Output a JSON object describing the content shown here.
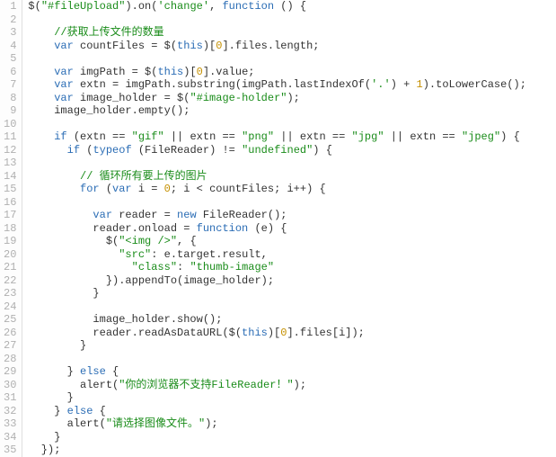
{
  "lines": [
    {
      "num": "1",
      "tokens": [
        {
          "t": "$(",
          "cls": "t"
        },
        {
          "t": "\"#fileUpload\"",
          "cls": "s"
        },
        {
          "t": ").on(",
          "cls": "t"
        },
        {
          "t": "'change'",
          "cls": "s"
        },
        {
          "t": ", ",
          "cls": "t"
        },
        {
          "t": "function",
          "cls": "k"
        },
        {
          "t": " () {",
          "cls": "t"
        }
      ]
    },
    {
      "num": "2",
      "tokens": []
    },
    {
      "num": "3",
      "tokens": [
        {
          "t": "    ",
          "cls": "t"
        },
        {
          "t": "//获取上传文件的数量",
          "cls": "c"
        }
      ]
    },
    {
      "num": "4",
      "tokens": [
        {
          "t": "    ",
          "cls": "t"
        },
        {
          "t": "var",
          "cls": "k"
        },
        {
          "t": " countFiles = $(",
          "cls": "t"
        },
        {
          "t": "this",
          "cls": "k"
        },
        {
          "t": ")[",
          "cls": "t"
        },
        {
          "t": "0",
          "cls": "n"
        },
        {
          "t": "].files.length;",
          "cls": "t"
        }
      ]
    },
    {
      "num": "5",
      "tokens": []
    },
    {
      "num": "6",
      "tokens": [
        {
          "t": "    ",
          "cls": "t"
        },
        {
          "t": "var",
          "cls": "k"
        },
        {
          "t": " imgPath = $(",
          "cls": "t"
        },
        {
          "t": "this",
          "cls": "k"
        },
        {
          "t": ")[",
          "cls": "t"
        },
        {
          "t": "0",
          "cls": "n"
        },
        {
          "t": "].value;",
          "cls": "t"
        }
      ]
    },
    {
      "num": "7",
      "tokens": [
        {
          "t": "    ",
          "cls": "t"
        },
        {
          "t": "var",
          "cls": "k"
        },
        {
          "t": " extn = imgPath.substring(imgPath.lastIndexOf(",
          "cls": "t"
        },
        {
          "t": "'.'",
          "cls": "s"
        },
        {
          "t": ") + ",
          "cls": "t"
        },
        {
          "t": "1",
          "cls": "n"
        },
        {
          "t": ").toLowerCase();",
          "cls": "t"
        }
      ]
    },
    {
      "num": "8",
      "tokens": [
        {
          "t": "    ",
          "cls": "t"
        },
        {
          "t": "var",
          "cls": "k"
        },
        {
          "t": " image_holder = $(",
          "cls": "t"
        },
        {
          "t": "\"#image-holder\"",
          "cls": "s"
        },
        {
          "t": ");",
          "cls": "t"
        }
      ]
    },
    {
      "num": "9",
      "tokens": [
        {
          "t": "    image_holder.empty();",
          "cls": "t"
        }
      ]
    },
    {
      "num": "10",
      "tokens": []
    },
    {
      "num": "11",
      "tokens": [
        {
          "t": "    ",
          "cls": "t"
        },
        {
          "t": "if",
          "cls": "k"
        },
        {
          "t": " (extn == ",
          "cls": "t"
        },
        {
          "t": "\"gif\"",
          "cls": "s"
        },
        {
          "t": " || extn == ",
          "cls": "t"
        },
        {
          "t": "\"png\"",
          "cls": "s"
        },
        {
          "t": " || extn == ",
          "cls": "t"
        },
        {
          "t": "\"jpg\"",
          "cls": "s"
        },
        {
          "t": " || extn == ",
          "cls": "t"
        },
        {
          "t": "\"jpeg\"",
          "cls": "s"
        },
        {
          "t": ") {",
          "cls": "t"
        }
      ]
    },
    {
      "num": "12",
      "tokens": [
        {
          "t": "      ",
          "cls": "t"
        },
        {
          "t": "if",
          "cls": "k"
        },
        {
          "t": " (",
          "cls": "t"
        },
        {
          "t": "typeof",
          "cls": "k"
        },
        {
          "t": " (FileReader) != ",
          "cls": "t"
        },
        {
          "t": "\"undefined\"",
          "cls": "s"
        },
        {
          "t": ") {",
          "cls": "t"
        }
      ]
    },
    {
      "num": "13",
      "tokens": []
    },
    {
      "num": "14",
      "tokens": [
        {
          "t": "        ",
          "cls": "t"
        },
        {
          "t": "// 循环所有要上传的图片",
          "cls": "c"
        }
      ]
    },
    {
      "num": "15",
      "tokens": [
        {
          "t": "        ",
          "cls": "t"
        },
        {
          "t": "for",
          "cls": "k"
        },
        {
          "t": " (",
          "cls": "t"
        },
        {
          "t": "var",
          "cls": "k"
        },
        {
          "t": " i = ",
          "cls": "t"
        },
        {
          "t": "0",
          "cls": "n"
        },
        {
          "t": "; i < countFiles; i++) {",
          "cls": "t"
        }
      ]
    },
    {
      "num": "16",
      "tokens": []
    },
    {
      "num": "17",
      "tokens": [
        {
          "t": "          ",
          "cls": "t"
        },
        {
          "t": "var",
          "cls": "k"
        },
        {
          "t": " reader = ",
          "cls": "t"
        },
        {
          "t": "new",
          "cls": "k"
        },
        {
          "t": " FileReader();",
          "cls": "t"
        }
      ]
    },
    {
      "num": "18",
      "tokens": [
        {
          "t": "          reader.onload = ",
          "cls": "t"
        },
        {
          "t": "function",
          "cls": "k"
        },
        {
          "t": " (e) {",
          "cls": "t"
        }
      ]
    },
    {
      "num": "19",
      "tokens": [
        {
          "t": "            $(",
          "cls": "t"
        },
        {
          "t": "\"<img />\"",
          "cls": "s"
        },
        {
          "t": ", {",
          "cls": "t"
        }
      ]
    },
    {
      "num": "20",
      "tokens": [
        {
          "t": "              ",
          "cls": "t"
        },
        {
          "t": "\"src\"",
          "cls": "s"
        },
        {
          "t": ": e.target.result,",
          "cls": "t"
        }
      ]
    },
    {
      "num": "21",
      "tokens": [
        {
          "t": "                ",
          "cls": "t"
        },
        {
          "t": "\"class\"",
          "cls": "s"
        },
        {
          "t": ": ",
          "cls": "t"
        },
        {
          "t": "\"thumb-image\"",
          "cls": "s"
        }
      ]
    },
    {
      "num": "22",
      "tokens": [
        {
          "t": "            }).appendTo(image_holder);",
          "cls": "t"
        }
      ]
    },
    {
      "num": "23",
      "tokens": [
        {
          "t": "          }",
          "cls": "t"
        }
      ]
    },
    {
      "num": "24",
      "tokens": []
    },
    {
      "num": "25",
      "tokens": [
        {
          "t": "          image_holder.show();",
          "cls": "t"
        }
      ]
    },
    {
      "num": "26",
      "tokens": [
        {
          "t": "          reader.readAsDataURL($(",
          "cls": "t"
        },
        {
          "t": "this",
          "cls": "k"
        },
        {
          "t": ")[",
          "cls": "t"
        },
        {
          "t": "0",
          "cls": "n"
        },
        {
          "t": "].files[i]);",
          "cls": "t"
        }
      ]
    },
    {
      "num": "27",
      "tokens": [
        {
          "t": "        }",
          "cls": "t"
        }
      ]
    },
    {
      "num": "28",
      "tokens": []
    },
    {
      "num": "29",
      "tokens": [
        {
          "t": "      } ",
          "cls": "t"
        },
        {
          "t": "else",
          "cls": "k"
        },
        {
          "t": " {",
          "cls": "t"
        }
      ]
    },
    {
      "num": "30",
      "tokens": [
        {
          "t": "        alert(",
          "cls": "t"
        },
        {
          "t": "\"你的浏览器不支持FileReader！\"",
          "cls": "s"
        },
        {
          "t": ");",
          "cls": "t"
        }
      ]
    },
    {
      "num": "31",
      "tokens": [
        {
          "t": "      }",
          "cls": "t"
        }
      ]
    },
    {
      "num": "32",
      "tokens": [
        {
          "t": "    } ",
          "cls": "t"
        },
        {
          "t": "else",
          "cls": "k"
        },
        {
          "t": " {",
          "cls": "t"
        }
      ]
    },
    {
      "num": "33",
      "tokens": [
        {
          "t": "      alert(",
          "cls": "t"
        },
        {
          "t": "\"请选择图像文件。\"",
          "cls": "s"
        },
        {
          "t": ");",
          "cls": "t"
        }
      ]
    },
    {
      "num": "34",
      "tokens": [
        {
          "t": "    }",
          "cls": "t"
        }
      ]
    },
    {
      "num": "35",
      "tokens": [
        {
          "t": "  });",
          "cls": "t"
        }
      ]
    }
  ]
}
